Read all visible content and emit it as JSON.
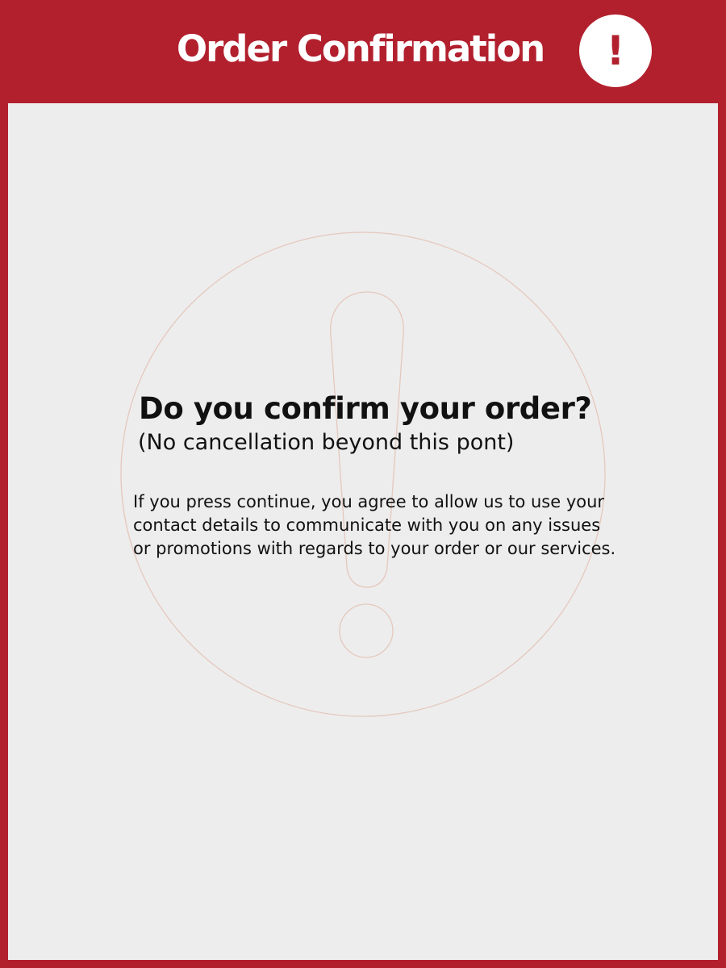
{
  "header": {
    "title": "Order Confirmation",
    "alert_symbol": "!",
    "alert_icon": "exclamation-icon",
    "background_color": "#b2202e"
  },
  "dialog": {
    "question": "Do you confirm your order?",
    "note": "(No cancellation beyond this pont)",
    "consent_text": "If you press continue, you agree to allow us to use your contact details to communicate with you on any issues or promotions with regards to your order or our services.",
    "watermark_icon": "warning-exclamation-icon",
    "background_color": "#ededed"
  }
}
